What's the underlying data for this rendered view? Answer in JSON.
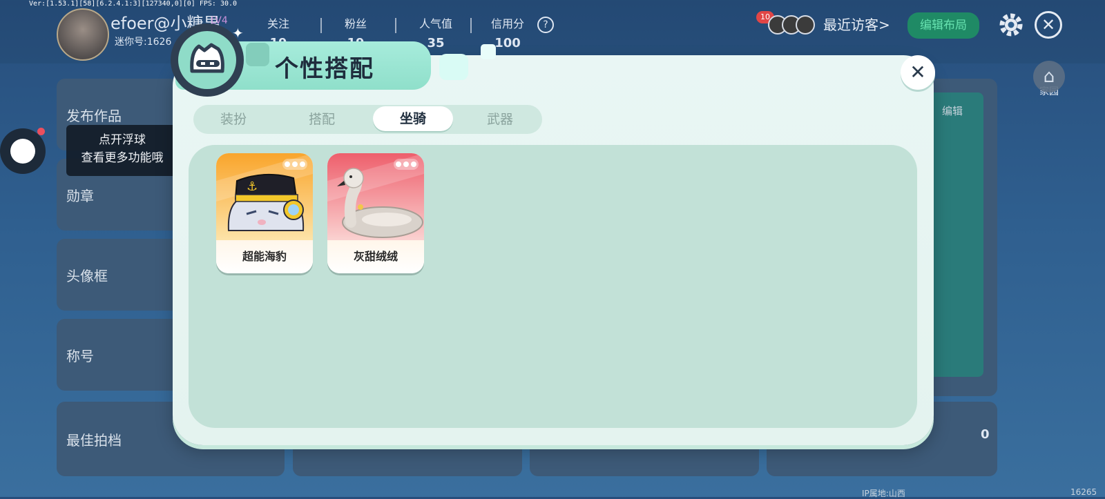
{
  "debug_text": "Ver:[1.53.1][58][6.2.4.1:3][127340,0][0] FPS: 30.0",
  "profile": {
    "name": "efoer@小糖果",
    "level": "LV4",
    "id": "迷你号:1626",
    "stats": [
      {
        "label": "关注",
        "value": "19"
      },
      {
        "label": "粉丝",
        "value": "19"
      },
      {
        "label": "人气值",
        "value": "35"
      },
      {
        "label": "信用分",
        "value": "100"
      }
    ]
  },
  "header": {
    "visitor_badge": "10",
    "visitors_label": "最近访客>",
    "edit_layout": "编辑布局",
    "home_label": "家园",
    "edit_right": "编辑"
  },
  "sidebar_cards": [
    "发布作品",
    "勋章",
    "头像框",
    "称号",
    "最佳拍档"
  ],
  "float_ball": {
    "line1": "点开浮球",
    "line2": "查看更多功能哦"
  },
  "bottom": {
    "score": "0",
    "location": "IP属地:山西",
    "id_tail": "16265"
  },
  "dialog": {
    "title": "个性搭配",
    "tabs": [
      {
        "label": "装扮",
        "active": false
      },
      {
        "label": "搭配",
        "active": false
      },
      {
        "label": "坐骑",
        "active": true
      },
      {
        "label": "武器",
        "active": false
      }
    ],
    "items": [
      {
        "name": "超能海豹",
        "icon": "seal-mount-art",
        "theme": "#f7b33a"
      },
      {
        "name": "灰甜绒绒",
        "icon": "swan-mount-art",
        "theme": "#f06d78"
      }
    ]
  }
}
